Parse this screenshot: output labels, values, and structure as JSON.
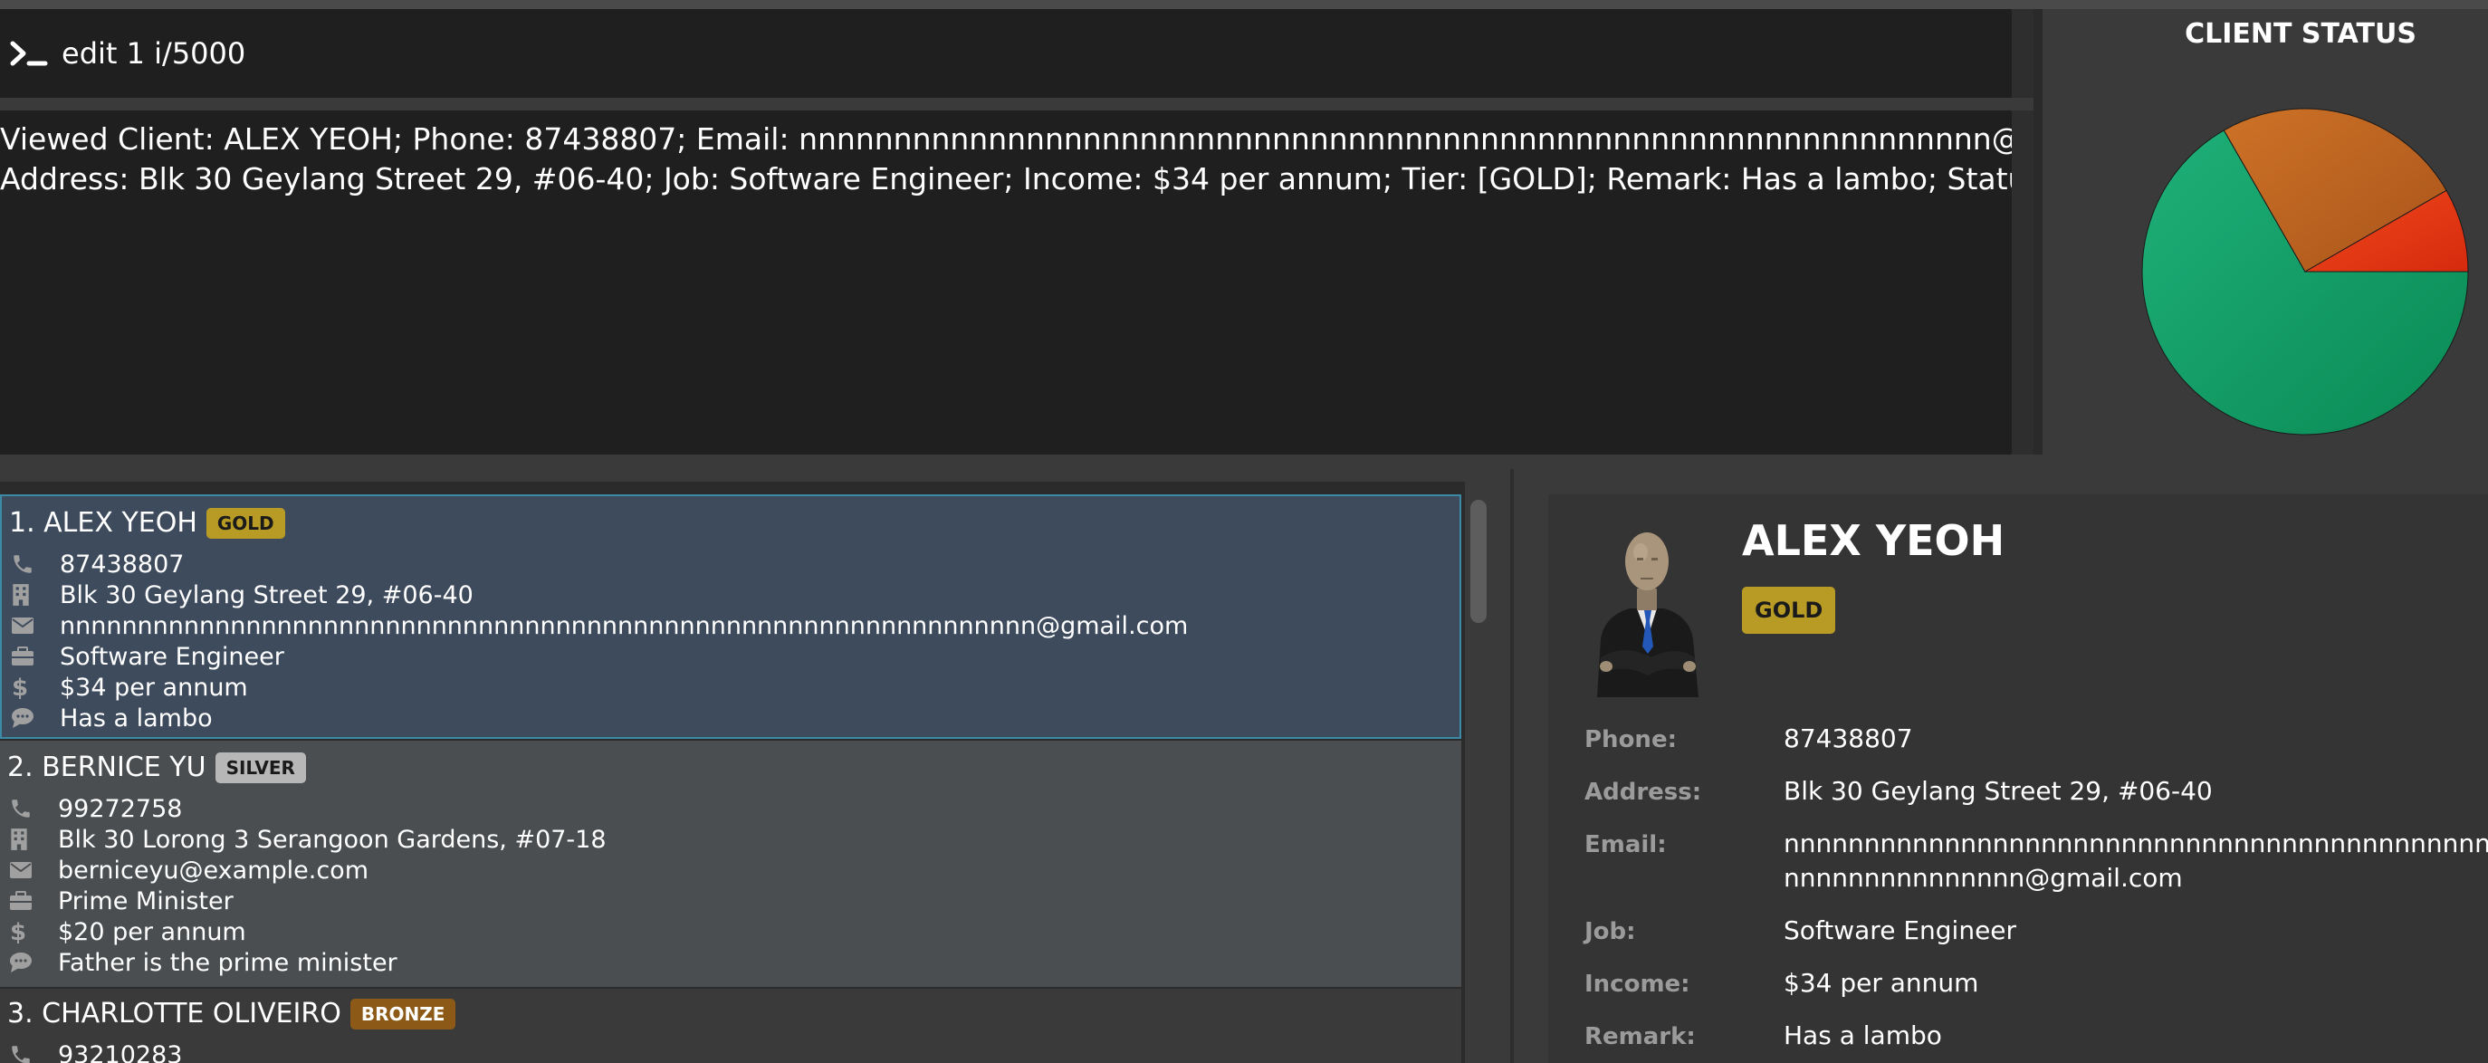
{
  "command": {
    "prompt_icon": "terminal-prompt-icon",
    "value": "edit 1 i/5000"
  },
  "result": {
    "line1": "Viewed Client: ALEX YEOH; Phone: 87438807; Email: nnnnnnnnnnnnnnnnnnnnnnnnnnnnnnnnnnnnnnnnnnnnnnnnnnnnnnnnnnnnnnn@gmail.com;",
    "line2": "Address: Blk 30 Geylang Street 29, #06-40; Job: Software Engineer; Income: $34 per annum; Tier: [GOLD]; Remark: Has a lambo; Status: [NA]"
  },
  "status_panel": {
    "title": "CLIENT STATUS",
    "chart_data": {
      "type": "pie",
      "title": "CLIENT STATUS",
      "slices": [
        {
          "value": 66.7,
          "color": "#16a068"
        },
        {
          "value": 25.0,
          "color": "#c0651e"
        },
        {
          "value": 8.3,
          "color": "#e63414"
        }
      ]
    }
  },
  "clients": [
    {
      "index_name": "1. ALEX YEOH",
      "tier": "GOLD",
      "phone": "87438807",
      "address": "Blk 30 Geylang Street 29, #06-40",
      "email": "nnnnnnnnnnnnnnnnnnnnnnnnnnnnnnnnnnnnnnnnnnnnnnnnnnnnnnnnnnnnnnn@gmail.com",
      "job": "Software Engineer",
      "income": "$34 per annum",
      "remark": "Has a lambo"
    },
    {
      "index_name": "2. BERNICE YU",
      "tier": "SILVER",
      "phone": "99272758",
      "address": "Blk 30 Lorong 3 Serangoon Gardens, #07-18",
      "email": "berniceyu@example.com",
      "job": "Prime Minister",
      "income": "$20 per annum",
      "remark": "Father is the prime minister"
    },
    {
      "index_name": "3. CHARLOTTE OLIVEIRO",
      "tier": "BRONZE",
      "phone": "93210283"
    }
  ],
  "detail": {
    "name": "ALEX YEOH",
    "tier": "GOLD",
    "labels": {
      "phone": "Phone:",
      "address": "Address:",
      "email": "Email:",
      "job": "Job:",
      "income": "Income:",
      "remark": "Remark:"
    },
    "phone": "87438807",
    "address": "Blk 30 Geylang Street 29, #06-40",
    "email_line1": "nnnnnnnnnnnnnnnnnnnnnnnnnnnnnnnnnnnnnnnnnnnnnnnn",
    "email_line2": "nnnnnnnnnnnnnnn@gmail.com",
    "job": "Software Engineer",
    "income": "$34 per annum",
    "remark": "Has a lambo"
  },
  "icons": [
    "phone-icon",
    "building-icon",
    "envelope-icon",
    "briefcase-icon",
    "dollar-icon",
    "comment-icon"
  ]
}
